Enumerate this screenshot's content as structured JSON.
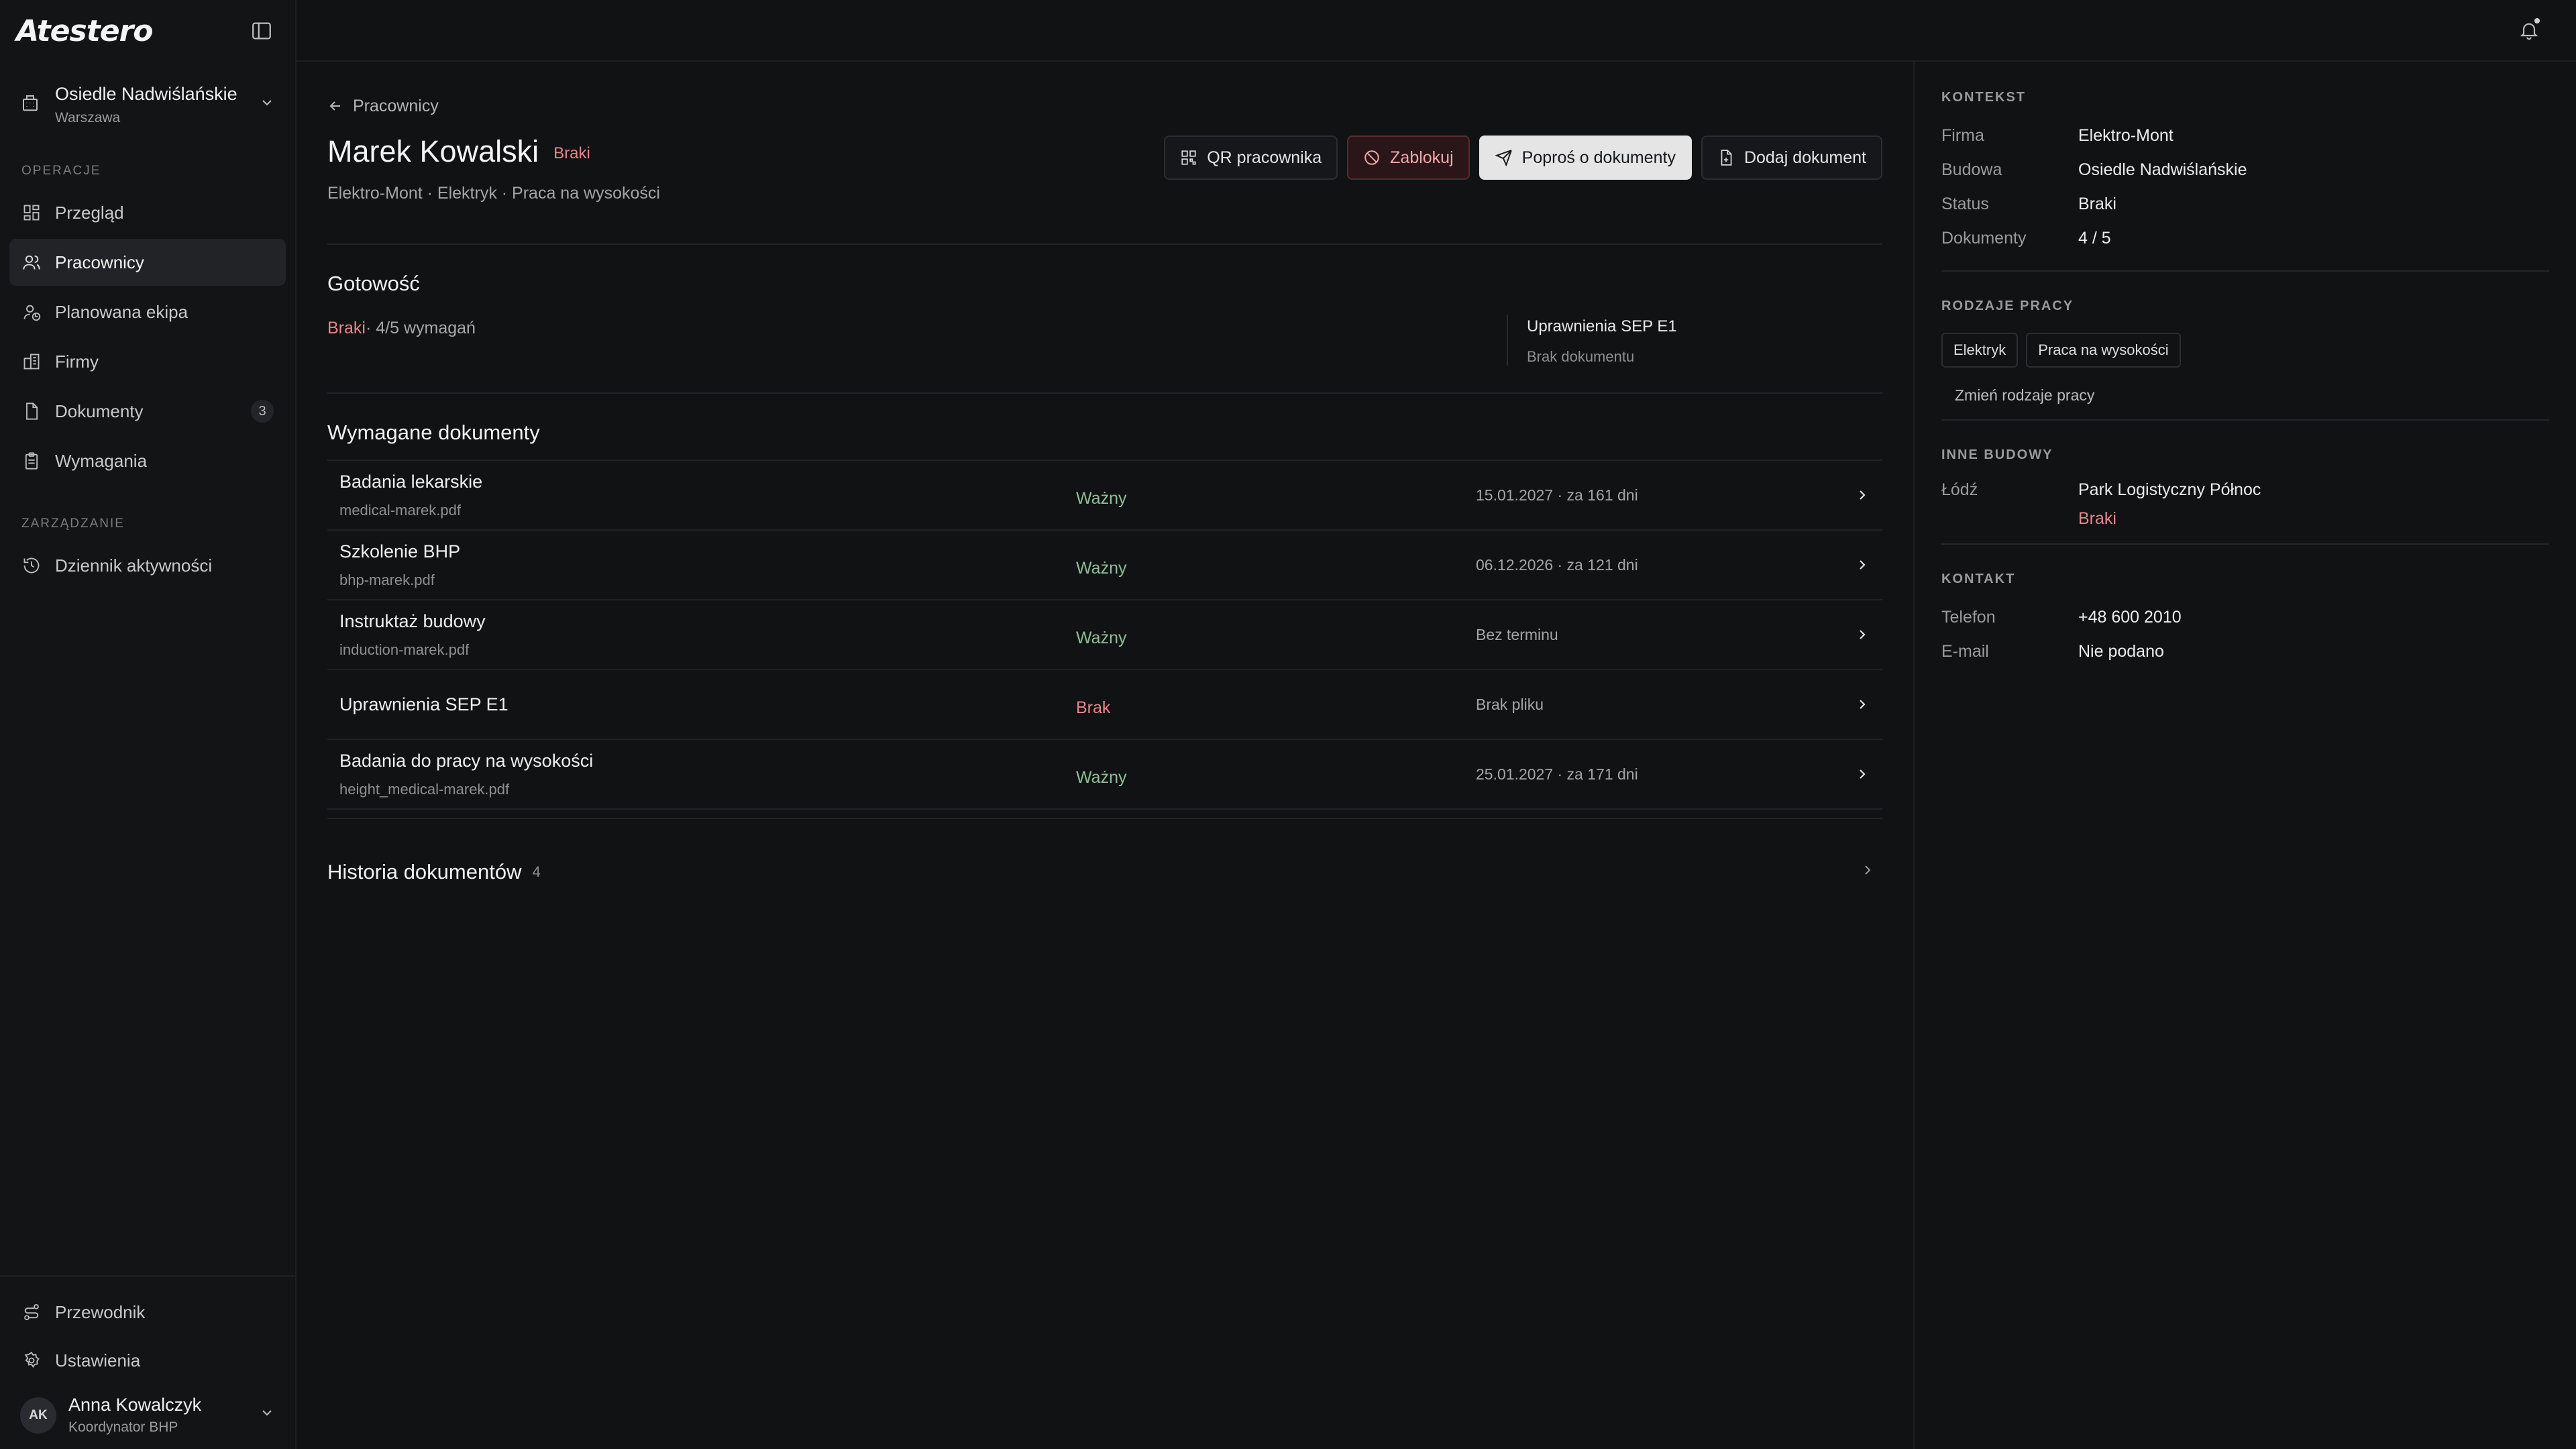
{
  "app": {
    "logo": "Atestero"
  },
  "site": {
    "name": "Osiedle Nadwiślańskie",
    "city": "Warszawa"
  },
  "nav": {
    "section_operations": "OPERACJE",
    "section_management": "ZARZĄDZANIE",
    "items": [
      {
        "label": "Przegląd",
        "icon": "grid-icon"
      },
      {
        "label": "Pracownicy",
        "icon": "users-icon",
        "active": true
      },
      {
        "label": "Planowana ekipa",
        "icon": "user-plan-icon"
      },
      {
        "label": "Firmy",
        "icon": "building-icon"
      },
      {
        "label": "Dokumenty",
        "icon": "document-icon",
        "count": "3"
      },
      {
        "label": "Wymagania",
        "icon": "clipboard-icon"
      }
    ],
    "management_items": [
      {
        "label": "Dziennik aktywności",
        "icon": "history-icon"
      }
    ],
    "bottom_items": [
      {
        "label": "Przewodnik",
        "icon": "route-icon"
      },
      {
        "label": "Ustawienia",
        "icon": "gear-icon"
      }
    ]
  },
  "user": {
    "initials": "AK",
    "name": "Anna Kowalczyk",
    "role": "Koordynator BHP"
  },
  "page": {
    "back_label": "Pracownicy",
    "title": "Marek Kowalski",
    "status": "Braki",
    "subtitle": "Elektro-Mont · Elektryk · Praca na wysokości",
    "actions": {
      "qr": "QR pracownika",
      "block": "Zablokuj",
      "request": "Poproś o dokumenty",
      "add": "Dodaj dokument"
    }
  },
  "readiness": {
    "title": "Gotowość",
    "status": "Braki",
    "summary": "· 4/5 wymagań",
    "missing_title": "Uprawnienia SEP E1",
    "missing_sub": "Brak dokumentu"
  },
  "documents": {
    "title": "Wymagane dokumenty",
    "rows": [
      {
        "name": "Badania lekarskie",
        "file": "medical-marek.pdf",
        "status": "Ważny",
        "valid": true,
        "date": "15.01.2027 · za 161 dni"
      },
      {
        "name": "Szkolenie BHP",
        "file": "bhp-marek.pdf",
        "status": "Ważny",
        "valid": true,
        "date": "06.12.2026 · za 121 dni"
      },
      {
        "name": "Instruktaż budowy",
        "file": "induction-marek.pdf",
        "status": "Ważny",
        "valid": true,
        "date": "Bez terminu"
      },
      {
        "name": "Uprawnienia SEP E1",
        "file": "",
        "status": "Brak",
        "valid": false,
        "date": "Brak pliku"
      },
      {
        "name": "Badania do pracy na wysokości",
        "file": "height_medical-marek.pdf",
        "status": "Ważny",
        "valid": true,
        "date": "25.01.2027 · za 171 dni"
      }
    ]
  },
  "history": {
    "title": "Historia dokumentów",
    "count": "4"
  },
  "context": {
    "label": "KONTEKST",
    "rows": [
      {
        "k": "Firma",
        "v": "Elektro-Mont"
      },
      {
        "k": "Budowa",
        "v": "Osiedle Nadwiślańskie"
      },
      {
        "k": "Status",
        "v": "Braki"
      },
      {
        "k": "Dokumenty",
        "v": "4 / 5"
      }
    ]
  },
  "work_types": {
    "label": "RODZAJE PRACY",
    "chips": [
      "Elektryk",
      "Praca na wysokości"
    ],
    "change": "Zmień rodzaje pracy"
  },
  "other_sites": {
    "label": "INNE BUDOWY",
    "city": "Łódź",
    "site": "Park Logistyczny Północ",
    "status": "Braki"
  },
  "contact": {
    "label": "KONTAKT",
    "phone_label": "Telefon",
    "phone": "+48 600 2010",
    "email_label": "E-mail",
    "email": "Nie podano"
  },
  "colors": {
    "danger": "#e6878a",
    "success": "#8fbf98",
    "background": "#111214"
  }
}
